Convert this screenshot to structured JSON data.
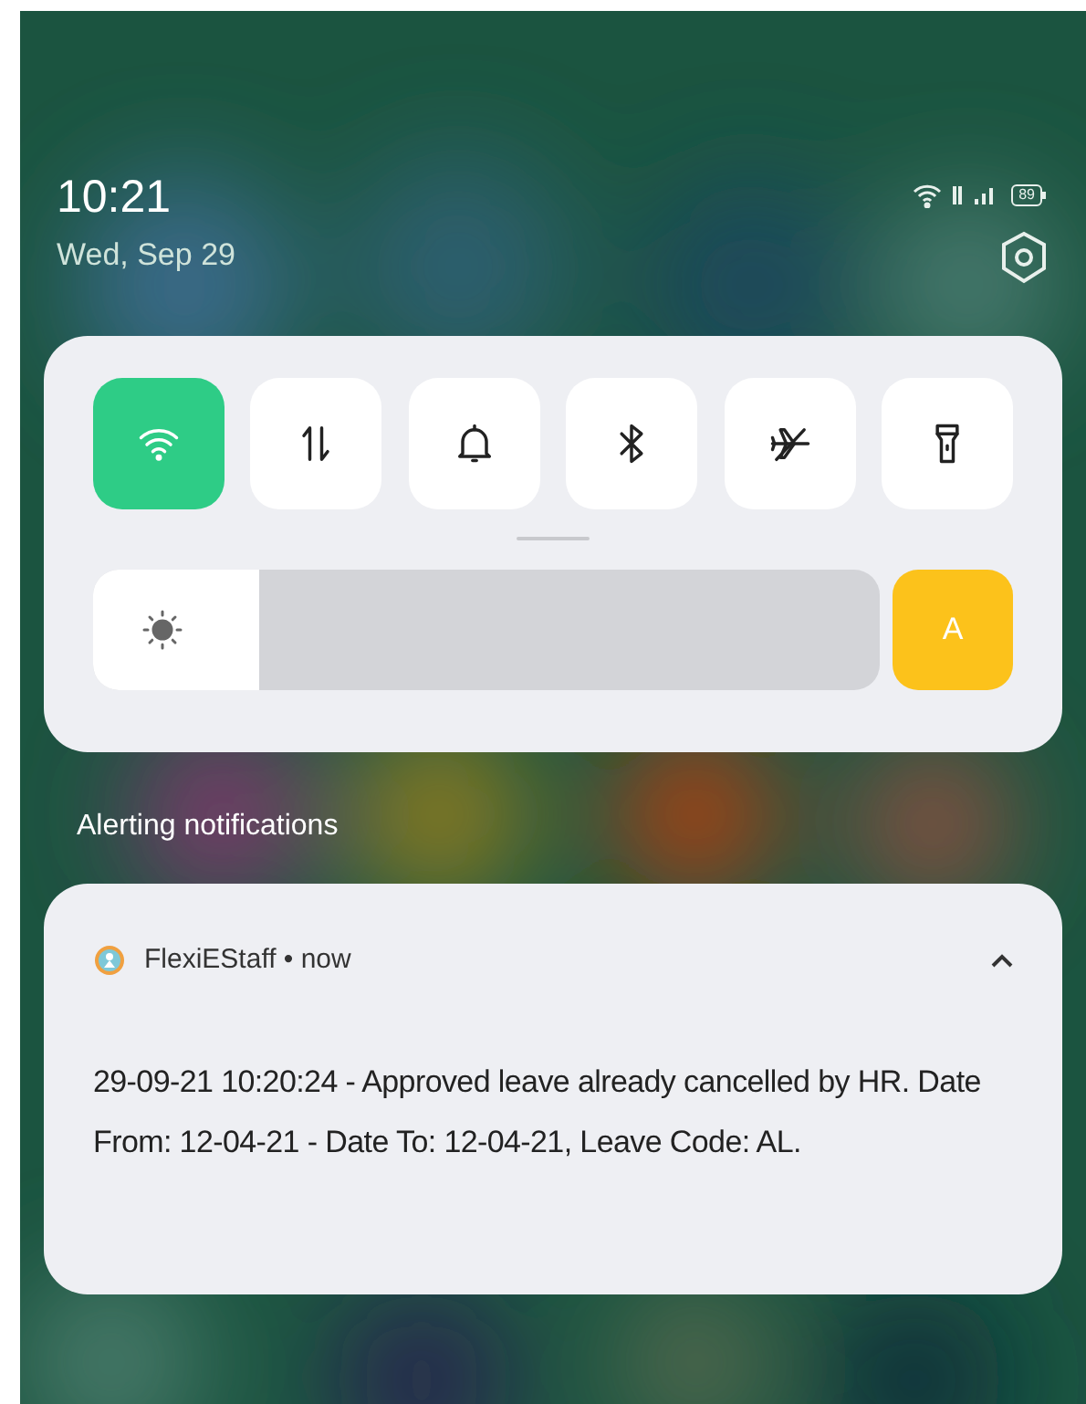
{
  "status_bar": {
    "time": "10:21",
    "date": "Wed, Sep 29",
    "battery": "89"
  },
  "quick_settings": {
    "tiles": [
      {
        "kind": "wifi",
        "on": true
      },
      {
        "kind": "data",
        "on": false
      },
      {
        "kind": "sound",
        "on": false
      },
      {
        "kind": "bluetooth",
        "on": false
      },
      {
        "kind": "airplane",
        "on": false
      },
      {
        "kind": "flashlight",
        "on": false
      }
    ],
    "brightness": {
      "level": 0.21,
      "auto_label": "A",
      "auto": true
    }
  },
  "section_title": "Alerting notifications",
  "notification": {
    "app": "FlexiEStaff",
    "separator": "•",
    "time": "now",
    "expanded": true,
    "text": "29-09-21 10:20:24 - Approved leave already cancelled by HR. Date From: 12-04-21 - Date To: 12-04-21, Leave Code: AL."
  }
}
